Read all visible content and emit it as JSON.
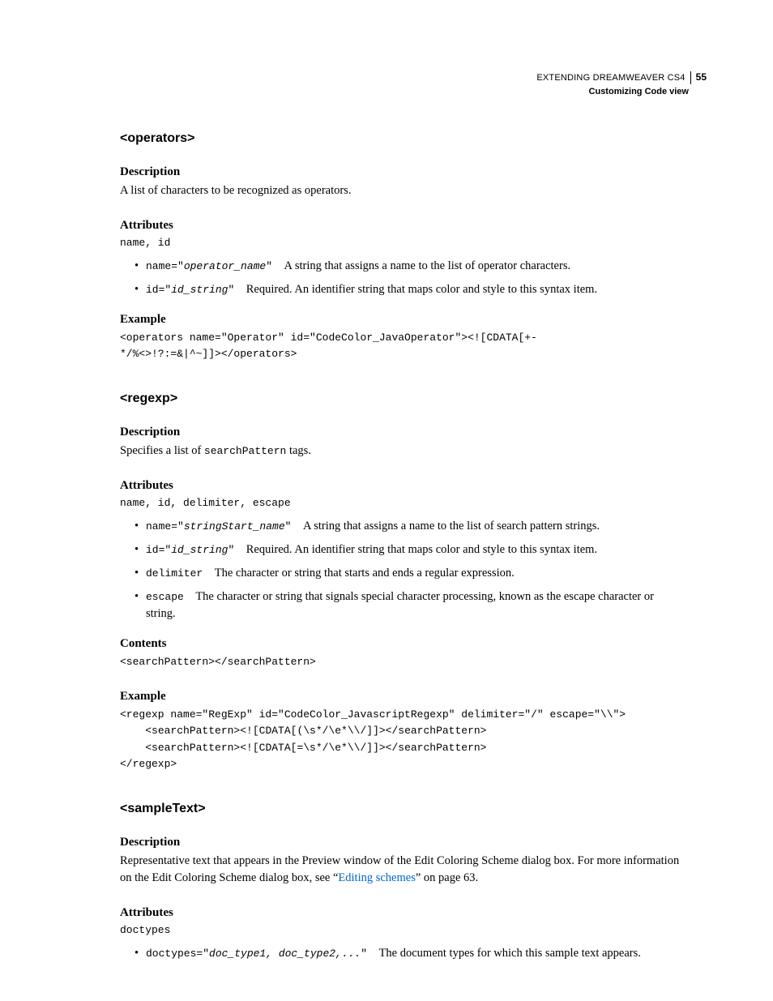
{
  "header": {
    "title": "EXTENDING DREAMWEAVER CS4",
    "page": "55",
    "subtitle": "Customizing Code view"
  },
  "s1": {
    "heading": "<operators>",
    "descLabel": "Description",
    "descText": "A list of characters to be recognized as operators.",
    "attrLabel": "Attributes",
    "attrList": "name, id",
    "b1_code": "name=\"operator_name\"",
    "b1_gap": " ",
    "b1_text": "A string that assigns a name to the list of operator characters.",
    "b2_code": "id=\"id_string\"",
    "b2_gap": " ",
    "b2_text": "Required. An identifier string that maps color and style to this syntax item.",
    "exLabel": "Example",
    "exCode": "<operators name=\"Operator\" id=\"CodeColor_JavaOperator\"><![CDATA[+-\n*/%<>!?:=&|^~]]></operators>"
  },
  "s2": {
    "heading": "<regexp>",
    "descLabel": "Description",
    "descPre": "Specifies a list of ",
    "descCode": "searchPattern",
    "descPost": " tags.",
    "attrLabel": "Attributes",
    "attrList": "name, id, delimiter, escape",
    "b1_code": "name=\"stringStart_name\"",
    "b1_gap": " ",
    "b1_text": "A string that assigns a name to the list of search pattern strings.",
    "b2_code": "id=\"id_string\"",
    "b2_gap": " ",
    "b2_text": "Required. An identifier string that maps color and style to this syntax item.",
    "b3_code": "delimiter",
    "b3_gap": " ",
    "b3_text": "The character or string that starts and ends a regular expression.",
    "b4_code": "escape",
    "b4_gap": " ",
    "b4_text": "The character or string that signals special character processing, known as the escape character or string.",
    "contLabel": "Contents",
    "contCode": "<searchPattern></searchPattern>",
    "exLabel": "Example",
    "exCode": "<regexp name=\"RegExp\" id=\"CodeColor_JavascriptRegexp\" delimiter=\"/\" escape=\"\\\\\">\n    <searchPattern><![CDATA[(\\s*/\\e*\\\\/]]></searchPattern>\n    <searchPattern><![CDATA[=\\s*/\\e*\\\\/]]></searchPattern>\n</regexp>"
  },
  "s3": {
    "heading": "<sampleText>",
    "descLabel": "Description",
    "descPre": "Representative text that appears in the Preview window of the Edit Coloring Scheme dialog box. For more information on the Edit Coloring Scheme dialog box, see “",
    "descLink": "Editing schemes",
    "descPost": "” on page 63.",
    "attrLabel": "Attributes",
    "attrList": "doctypes",
    "b1_code": "doctypes=\"doc_type1, doc_type2,...\"",
    "b1_gap": " ",
    "b1_text": "The document types for which this sample text appears."
  }
}
